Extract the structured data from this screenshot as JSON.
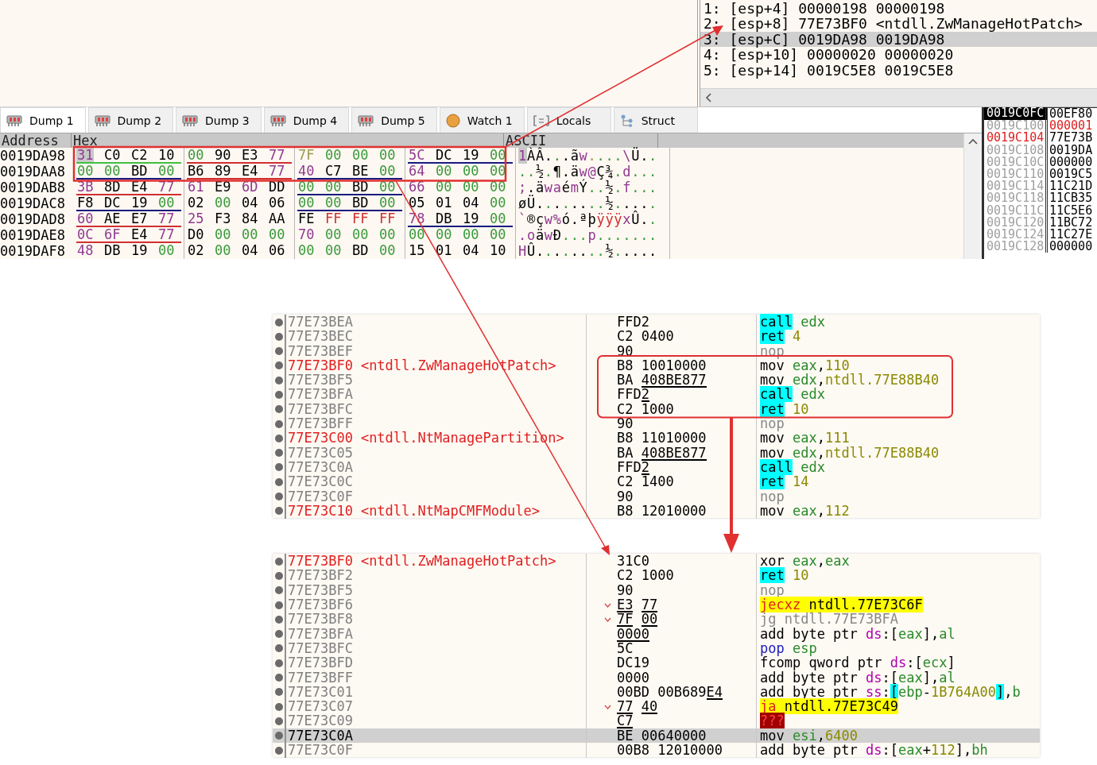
{
  "stack": {
    "rows": [
      {
        "text": "1: [esp+4] 00000198 00000198",
        "selected": false
      },
      {
        "text": "2: [esp+8] 77E73BF0 <ntdll.ZwManageHotPatch>",
        "selected": false
      },
      {
        "text": "3: [esp+C] 0019DA98 0019DA98",
        "selected": true
      },
      {
        "text": "4: [esp+10] 00000020 00000020",
        "selected": false
      },
      {
        "text": "5: [esp+14] 0019C5E8 0019C5E8",
        "selected": false
      }
    ]
  },
  "dump_tabs": [
    {
      "label": "Dump 1",
      "kind": "dump",
      "selected": true
    },
    {
      "label": "Dump 2",
      "kind": "dump",
      "selected": false
    },
    {
      "label": "Dump 3",
      "kind": "dump",
      "selected": false
    },
    {
      "label": "Dump 4",
      "kind": "dump",
      "selected": false
    },
    {
      "label": "Dump 5",
      "kind": "dump",
      "selected": false
    },
    {
      "label": "Watch 1",
      "kind": "watch",
      "selected": false
    },
    {
      "label": "Locals",
      "kind": "locals",
      "selected": false
    },
    {
      "label": "Struct",
      "kind": "struct",
      "selected": false
    }
  ],
  "dump": {
    "columns": [
      "Address",
      "Hex",
      "ASCII"
    ],
    "rows": [
      {
        "address": "0019DA98",
        "groups": [
          {
            "color": "#40c040",
            "bytes": [
              {
                "text": "31",
                "color": "#903a90",
                "selected": true
              },
              {
                "text": "C0",
                "color": "#000000",
                "selected": false
              },
              {
                "text": "C2",
                "color": "#000000",
                "selected": false
              },
              {
                "text": "10",
                "color": "#000000",
                "selected": false
              }
            ]
          },
          {
            "color": "#d03030",
            "bytes": [
              {
                "text": "00",
                "color": "#3a9a3a",
                "selected": false
              },
              {
                "text": "90",
                "color": "#000000",
                "selected": false
              },
              {
                "text": "E3",
                "color": "#000000",
                "selected": false
              },
              {
                "text": "77",
                "color": "#903a90",
                "selected": false
              }
            ]
          },
          {
            "bytes": [
              {
                "text": "7F",
                "color": "#9a9a50",
                "selected": false
              },
              {
                "text": "00",
                "color": "#3a9a3a",
                "selected": false
              },
              {
                "text": "00",
                "color": "#3a9a3a",
                "selected": false
              },
              {
                "text": "00",
                "color": "#3a9a3a",
                "selected": false
              }
            ]
          },
          {
            "color": "#1a1a80",
            "bytes": [
              {
                "text": "5C",
                "color": "#903a90",
                "selected": false
              },
              {
                "text": "DC",
                "color": "#000000",
                "selected": false
              },
              {
                "text": "19",
                "color": "#000000",
                "selected": false
              },
              {
                "text": "00",
                "color": "#3a9a3a",
                "selected": false
              }
            ]
          }
        ],
        "ascii": "1ÀÂ...ãw....\\Ü.."
      },
      {
        "address": "0019DAA8",
        "groups": [
          {
            "color": "#1a1a80",
            "bytes": [
              {
                "text": "00",
                "color": "#3a9a3a",
                "selected": false
              },
              {
                "text": "00",
                "color": "#3a9a3a",
                "selected": false
              },
              {
                "text": "BD",
                "color": "#000000",
                "selected": false
              },
              {
                "text": "00",
                "color": "#3a9a3a",
                "selected": false
              }
            ]
          },
          {
            "color": "#d03030",
            "bytes": [
              {
                "text": "B6",
                "color": "#000000",
                "selected": false
              },
              {
                "text": "89",
                "color": "#000000",
                "selected": false
              },
              {
                "text": "E4",
                "color": "#000000",
                "selected": false
              },
              {
                "text": "77",
                "color": "#903a90",
                "selected": false
              }
            ]
          },
          {
            "color": "#1a1a80",
            "bytes": [
              {
                "text": "40",
                "color": "#903a90",
                "selected": false
              },
              {
                "text": "C7",
                "color": "#000000",
                "selected": false
              },
              {
                "text": "BE",
                "color": "#000000",
                "selected": false
              },
              {
                "text": "00",
                "color": "#3a9a3a",
                "selected": false
              }
            ]
          },
          {
            "bytes": [
              {
                "text": "64",
                "color": "#903a90",
                "selected": false
              },
              {
                "text": "00",
                "color": "#3a9a3a",
                "selected": false
              },
              {
                "text": "00",
                "color": "#3a9a3a",
                "selected": false
              },
              {
                "text": "00",
                "color": "#3a9a3a",
                "selected": false
              }
            ]
          }
        ],
        "ascii": "..½.¶.äw@Ç¾.d..."
      },
      {
        "address": "0019DAB8",
        "groups": [
          {
            "color": "#d03030",
            "bytes": [
              {
                "text": "3B",
                "color": "#903a90",
                "selected": false
              },
              {
                "text": "8D",
                "color": "#000000",
                "selected": false
              },
              {
                "text": "E4",
                "color": "#000000",
                "selected": false
              },
              {
                "text": "77",
                "color": "#903a90",
                "selected": false
              }
            ]
          },
          {
            "bytes": [
              {
                "text": "61",
                "color": "#903a90",
                "selected": false
              },
              {
                "text": "E9",
                "color": "#000000",
                "selected": false
              },
              {
                "text": "6D",
                "color": "#903a90",
                "selected": false
              },
              {
                "text": "DD",
                "color": "#000000",
                "selected": false
              }
            ]
          },
          {
            "color": "#1a1a80",
            "bytes": [
              {
                "text": "00",
                "color": "#3a9a3a",
                "selected": false
              },
              {
                "text": "00",
                "color": "#3a9a3a",
                "selected": false
              },
              {
                "text": "BD",
                "color": "#000000",
                "selected": false
              },
              {
                "text": "00",
                "color": "#3a9a3a",
                "selected": false
              }
            ]
          },
          {
            "bytes": [
              {
                "text": "66",
                "color": "#903a90",
                "selected": false
              },
              {
                "text": "00",
                "color": "#3a9a3a",
                "selected": false
              },
              {
                "text": "00",
                "color": "#3a9a3a",
                "selected": false
              },
              {
                "text": "00",
                "color": "#3a9a3a",
                "selected": false
              }
            ]
          }
        ],
        "ascii": ";.äwaémÝ..½.f..."
      },
      {
        "address": "0019DAC8",
        "groups": [
          {
            "color": "#1a1a80",
            "bytes": [
              {
                "text": "F8",
                "color": "#000000",
                "selected": false
              },
              {
                "text": "DC",
                "color": "#000000",
                "selected": false
              },
              {
                "text": "19",
                "color": "#000000",
                "selected": false
              },
              {
                "text": "00",
                "color": "#3a9a3a",
                "selected": false
              }
            ]
          },
          {
            "bytes": [
              {
                "text": "02",
                "color": "#000000",
                "selected": false
              },
              {
                "text": "00",
                "color": "#3a9a3a",
                "selected": false
              },
              {
                "text": "04",
                "color": "#000000",
                "selected": false
              },
              {
                "text": "06",
                "color": "#000000",
                "selected": false
              }
            ]
          },
          {
            "color": "#1a1a80",
            "bytes": [
              {
                "text": "00",
                "color": "#3a9a3a",
                "selected": false
              },
              {
                "text": "00",
                "color": "#3a9a3a",
                "selected": false
              },
              {
                "text": "BD",
                "color": "#000000",
                "selected": false
              },
              {
                "text": "00",
                "color": "#3a9a3a",
                "selected": false
              }
            ]
          },
          {
            "bytes": [
              {
                "text": "05",
                "color": "#000000",
                "selected": false
              },
              {
                "text": "01",
                "color": "#000000",
                "selected": false
              },
              {
                "text": "04",
                "color": "#000000",
                "selected": false
              },
              {
                "text": "00",
                "color": "#3a9a3a",
                "selected": false
              }
            ]
          }
        ],
        "ascii": "øÜ........½....."
      },
      {
        "address": "0019DAD8",
        "groups": [
          {
            "color": "#d03030",
            "bytes": [
              {
                "text": "60",
                "color": "#903a90",
                "selected": false
              },
              {
                "text": "AE",
                "color": "#000000",
                "selected": false
              },
              {
                "text": "E7",
                "color": "#000000",
                "selected": false
              },
              {
                "text": "77",
                "color": "#903a90",
                "selected": false
              }
            ]
          },
          {
            "bytes": [
              {
                "text": "25",
                "color": "#903a90",
                "selected": false
              },
              {
                "text": "F3",
                "color": "#000000",
                "selected": false
              },
              {
                "text": "84",
                "color": "#000000",
                "selected": false
              },
              {
                "text": "AA",
                "color": "#000000",
                "selected": false
              }
            ]
          },
          {
            "bytes": [
              {
                "text": "FE",
                "color": "#000000",
                "selected": false
              },
              {
                "text": "FF",
                "color": "#d03030",
                "selected": false
              },
              {
                "text": "FF",
                "color": "#d03030",
                "selected": false
              },
              {
                "text": "FF",
                "color": "#d03030",
                "selected": false
              }
            ]
          },
          {
            "color": "#1a1a80",
            "bytes": [
              {
                "text": "78",
                "color": "#903a90",
                "selected": false
              },
              {
                "text": "DB",
                "color": "#000000",
                "selected": false
              },
              {
                "text": "19",
                "color": "#000000",
                "selected": false
              },
              {
                "text": "00",
                "color": "#3a9a3a",
                "selected": false
              }
            ]
          }
        ],
        "ascii": "`®çw%ó.ªþÿÿÿxÛ.."
      },
      {
        "address": "0019DAE8",
        "groups": [
          {
            "color": "#d03030",
            "bytes": [
              {
                "text": "0C",
                "color": "#903a90",
                "selected": false
              },
              {
                "text": "6F",
                "color": "#903a90",
                "selected": false
              },
              {
                "text": "E4",
                "color": "#000000",
                "selected": false
              },
              {
                "text": "77",
                "color": "#903a90",
                "selected": false
              }
            ]
          },
          {
            "bytes": [
              {
                "text": "D0",
                "color": "#000000",
                "selected": false
              },
              {
                "text": "00",
                "color": "#3a9a3a",
                "selected": false
              },
              {
                "text": "00",
                "color": "#3a9a3a",
                "selected": false
              },
              {
                "text": "00",
                "color": "#3a9a3a",
                "selected": false
              }
            ]
          },
          {
            "bytes": [
              {
                "text": "70",
                "color": "#903a90",
                "selected": false
              },
              {
                "text": "00",
                "color": "#3a9a3a",
                "selected": false
              },
              {
                "text": "00",
                "color": "#3a9a3a",
                "selected": false
              },
              {
                "text": "00",
                "color": "#3a9a3a",
                "selected": false
              }
            ]
          },
          {
            "bytes": [
              {
                "text": "00",
                "color": "#3a9a3a",
                "selected": false
              },
              {
                "text": "00",
                "color": "#3a9a3a",
                "selected": false
              },
              {
                "text": "00",
                "color": "#3a9a3a",
                "selected": false
              },
              {
                "text": "00",
                "color": "#3a9a3a",
                "selected": false
              }
            ]
          }
        ],
        "ascii": ".oäwÐ...p......."
      },
      {
        "address": "0019DAF8",
        "groups": [
          {
            "bytes": [
              {
                "text": "48",
                "color": "#903a90",
                "selected": false
              },
              {
                "text": "DB",
                "color": "#000000",
                "selected": false
              },
              {
                "text": "19",
                "color": "#000000",
                "selected": false
              },
              {
                "text": "00",
                "color": "#3a9a3a",
                "selected": false
              }
            ]
          },
          {
            "bytes": [
              {
                "text": "02",
                "color": "#000000",
                "selected": false
              },
              {
                "text": "00",
                "color": "#3a9a3a",
                "selected": false
              },
              {
                "text": "04",
                "color": "#000000",
                "selected": false
              },
              {
                "text": "06",
                "color": "#000000",
                "selected": false
              }
            ]
          },
          {
            "bytes": [
              {
                "text": "00",
                "color": "#3a9a3a",
                "selected": false
              },
              {
                "text": "00",
                "color": "#3a9a3a",
                "selected": false
              },
              {
                "text": "BD",
                "color": "#000000",
                "selected": false
              },
              {
                "text": "00",
                "color": "#3a9a3a",
                "selected": false
              }
            ]
          },
          {
            "bytes": [
              {
                "text": "15",
                "color": "#000000",
                "selected": false
              },
              {
                "text": "01",
                "color": "#000000",
                "selected": false
              },
              {
                "text": "04",
                "color": "#000000",
                "selected": false
              },
              {
                "text": "10",
                "color": "#000000",
                "selected": false
              }
            ]
          }
        ],
        "ascii": "HÛ........½....."
      }
    ]
  },
  "mini_stack": {
    "header": [
      "0019C0FC",
      "00EF80"
    ],
    "rows": [
      {
        "address": {
          "text": "0019C100",
          "color": "#a0a0a0"
        },
        "value": {
          "text": "000001",
          "color": "#e02020"
        }
      },
      {
        "address": {
          "text": "0019C104",
          "color": "#e02020"
        },
        "value": {
          "text": "77E73B",
          "color": "#000000"
        }
      },
      {
        "address": {
          "text": "0019C108",
          "color": "#a0a0a0"
        },
        "value": {
          "text": "0019DA",
          "color": "#000000"
        }
      },
      {
        "address": {
          "text": "0019C10C",
          "color": "#a0a0a0"
        },
        "value": {
          "text": "000000",
          "color": "#000000"
        }
      },
      {
        "address": {
          "text": "0019C110",
          "color": "#a0a0a0"
        },
        "value": {
          "text": "0019C5",
          "color": "#000000"
        }
      },
      {
        "address": {
          "text": "0019C114",
          "color": "#a0a0a0"
        },
        "value": {
          "text": "11C21D",
          "color": "#000000"
        }
      },
      {
        "address": {
          "text": "0019C118",
          "color": "#a0a0a0"
        },
        "value": {
          "text": "11CB35",
          "color": "#000000"
        }
      },
      {
        "address": {
          "text": "0019C11C",
          "color": "#a0a0a0"
        },
        "value": {
          "text": "11C5E6",
          "color": "#000000"
        }
      },
      {
        "address": {
          "text": "0019C120",
          "color": "#a0a0a0"
        },
        "value": {
          "text": "11BC72",
          "color": "#000000"
        }
      },
      {
        "address": {
          "text": "0019C124",
          "color": "#a0a0a0"
        },
        "value": {
          "text": "11C27E",
          "color": "#000000"
        }
      },
      {
        "address": {
          "text": "0019C128",
          "color": "#a0a0a0"
        },
        "value": {
          "text": "000000",
          "color": "#000000"
        }
      }
    ]
  },
  "disassembly": [
    {
      "rows": [
        {
          "address": "77E73BEA",
          "selected": false,
          "jump": false,
          "bytes": [
            {
              "text": "FFD2",
              "underlined": false
            }
          ],
          "instruction": [
            {
              "text": "call",
              "kind": "control"
            },
            {
              "text": " edx",
              "kind": "register"
            }
          ]
        },
        {
          "address": "77E73BEC",
          "selected": false,
          "jump": false,
          "bytes": [
            {
              "text": "C2 0400",
              "underlined": false
            }
          ],
          "instruction": [
            {
              "text": "ret",
              "kind": "control"
            },
            {
              "text": " 4",
              "kind": "number"
            }
          ]
        },
        {
          "address": "77E73BEF",
          "selected": false,
          "jump": false,
          "bytes": [
            {
              "text": "90",
              "underlined": false
            }
          ],
          "instruction": [
            {
              "text": "nop",
              "kind": "muted"
            }
          ]
        },
        {
          "address": "77E73BF0",
          "label": "<ntdll.ZwManageHotPatch>",
          "selected": false,
          "jump": false,
          "bytes": [
            {
              "text": "B8 10010000",
              "underlined": false
            }
          ],
          "instruction": [
            {
              "text": "mov ",
              "kind": "plain"
            },
            {
              "text": "eax",
              "kind": "register"
            },
            {
              "text": ",",
              "kind": "plain"
            },
            {
              "text": "110",
              "kind": "number"
            }
          ]
        },
        {
          "address": "77E73BF5",
          "selected": false,
          "jump": false,
          "bytes": [
            {
              "text": "BA ",
              "underlined": false
            },
            {
              "text": "408BE877",
              "underlined": true
            }
          ],
          "instruction": [
            {
              "text": "mov ",
              "kind": "plain"
            },
            {
              "text": "edx",
              "kind": "register"
            },
            {
              "text": ",",
              "kind": "plain"
            },
            {
              "text": "ntdll.77E88B40",
              "kind": "number"
            }
          ]
        },
        {
          "address": "77E73BFA",
          "selected": false,
          "jump": false,
          "bytes": [
            {
              "text": "FFD",
              "underlined": false
            },
            {
              "text": "2",
              "underlined": true
            }
          ],
          "instruction": [
            {
              "text": "call",
              "kind": "control"
            },
            {
              "text": " edx",
              "kind": "register"
            }
          ]
        },
        {
          "address": "77E73BFC",
          "selected": false,
          "jump": false,
          "bytes": [
            {
              "text": "C2 1000",
              "underlined": false
            }
          ],
          "instruction": [
            {
              "text": "ret",
              "kind": "control"
            },
            {
              "text": " 10",
              "kind": "number"
            }
          ]
        },
        {
          "address": "77E73BFF",
          "selected": false,
          "jump": false,
          "bytes": [
            {
              "text": "90",
              "underlined": false
            }
          ],
          "instruction": [
            {
              "text": "nop",
              "kind": "muted"
            }
          ]
        },
        {
          "address": "77E73C00",
          "label": "<ntdll.NtManagePartition>",
          "selected": false,
          "jump": false,
          "bytes": [
            {
              "text": "B8 11010000",
              "underlined": false
            }
          ],
          "instruction": [
            {
              "text": "mov ",
              "kind": "plain"
            },
            {
              "text": "eax",
              "kind": "register"
            },
            {
              "text": ",",
              "kind": "plain"
            },
            {
              "text": "111",
              "kind": "number"
            }
          ]
        },
        {
          "address": "77E73C05",
          "selected": false,
          "jump": false,
          "bytes": [
            {
              "text": "BA ",
              "underlined": false
            },
            {
              "text": "408BE877",
              "underlined": true
            }
          ],
          "instruction": [
            {
              "text": "mov ",
              "kind": "plain"
            },
            {
              "text": "edx",
              "kind": "register"
            },
            {
              "text": ",",
              "kind": "plain"
            },
            {
              "text": "ntdll.77E88B40",
              "kind": "number"
            }
          ]
        },
        {
          "address": "77E73C0A",
          "selected": false,
          "jump": false,
          "bytes": [
            {
              "text": "FFD",
              "underlined": false
            },
            {
              "text": "2",
              "underlined": true
            }
          ],
          "instruction": [
            {
              "text": "call",
              "kind": "control"
            },
            {
              "text": " edx",
              "kind": "register"
            }
          ]
        },
        {
          "address": "77E73C0C",
          "selected": false,
          "jump": false,
          "bytes": [
            {
              "text": "C2 1400",
              "underlined": false
            }
          ],
          "instruction": [
            {
              "text": "ret",
              "kind": "control"
            },
            {
              "text": " 14",
              "kind": "number"
            }
          ]
        },
        {
          "address": "77E73C0F",
          "selected": false,
          "jump": false,
          "bytes": [
            {
              "text": "90",
              "underlined": false
            }
          ],
          "instruction": [
            {
              "text": "nop",
              "kind": "muted"
            }
          ]
        },
        {
          "address": "77E73C10",
          "label": "<ntdll.NtMapCMFModule>",
          "selected": false,
          "jump": false,
          "bytes": [
            {
              "text": "B8 12010000",
              "underlined": false
            }
          ],
          "instruction": [
            {
              "text": "mov ",
              "kind": "plain"
            },
            {
              "text": "eax",
              "kind": "register"
            },
            {
              "text": ",",
              "kind": "plain"
            },
            {
              "text": "112",
              "kind": "number"
            }
          ]
        }
      ]
    },
    {
      "rows": [
        {
          "address": "77E73BF0",
          "label": "<ntdll.ZwManageHotPatch>",
          "selected": false,
          "jump": false,
          "bytes": [
            {
              "text": "31C0",
              "underlined": false
            }
          ],
          "instruction": [
            {
              "text": "xor ",
              "kind": "plain"
            },
            {
              "text": "eax",
              "kind": "register"
            },
            {
              "text": ",",
              "kind": "plain"
            },
            {
              "text": "eax",
              "kind": "register"
            }
          ]
        },
        {
          "address": "77E73BF2",
          "selected": false,
          "jump": false,
          "bytes": [
            {
              "text": "C2 1000",
              "underlined": false
            }
          ],
          "instruction": [
            {
              "text": "ret",
              "kind": "control"
            },
            {
              "text": " 10",
              "kind": "number"
            }
          ]
        },
        {
          "address": "77E73BF5",
          "selected": false,
          "jump": false,
          "bytes": [
            {
              "text": "90",
              "underlined": false
            }
          ],
          "instruction": [
            {
              "text": "nop",
              "kind": "muted"
            }
          ]
        },
        {
          "address": "77E73BF6",
          "selected": false,
          "jump": true,
          "bytes": [
            {
              "text": "E3",
              "underlined": true
            },
            {
              "text": " 77",
              "underlined": true
            }
          ],
          "instruction": [
            {
              "text": "jecxz",
              "kind": "branch"
            },
            {
              "text": " ntdll.77E73C6F",
              "kind": "target"
            }
          ]
        },
        {
          "address": "77E73BF8",
          "selected": false,
          "jump": true,
          "bytes": [
            {
              "text": "7F",
              "underlined": true
            },
            {
              "text": " 00",
              "underlined": true
            }
          ],
          "instruction": [
            {
              "text": "jg ntdll.77E73BFA",
              "kind": "muted"
            }
          ]
        },
        {
          "address": "77E73BFA",
          "selected": false,
          "jump": false,
          "bytes": [
            {
              "text": "0000",
              "underlined": true
            }
          ],
          "instruction": [
            {
              "text": "add byte ptr ",
              "kind": "plain"
            },
            {
              "text": "ds",
              "kind": "segment"
            },
            {
              "text": ":[",
              "kind": "plain"
            },
            {
              "text": "eax",
              "kind": "register"
            },
            {
              "text": "],",
              "kind": "plain"
            },
            {
              "text": "al",
              "kind": "register"
            }
          ]
        },
        {
          "address": "77E73BFC",
          "selected": false,
          "jump": false,
          "bytes": [
            {
              "text": "5C",
              "underlined": false
            }
          ],
          "instruction": [
            {
              "text": "pop",
              "kind": "stack"
            },
            {
              "text": " esp",
              "kind": "register"
            }
          ]
        },
        {
          "address": "77E73BFD",
          "selected": false,
          "jump": false,
          "bytes": [
            {
              "text": "DC19",
              "underlined": false
            }
          ],
          "instruction": [
            {
              "text": "fcomp qword ptr ",
              "kind": "plain"
            },
            {
              "text": "ds",
              "kind": "segment"
            },
            {
              "text": ":[",
              "kind": "plain"
            },
            {
              "text": "ecx",
              "kind": "register"
            },
            {
              "text": "]",
              "kind": "plain"
            }
          ]
        },
        {
          "address": "77E73BFF",
          "selected": false,
          "jump": false,
          "bytes": [
            {
              "text": "0000",
              "underlined": false
            }
          ],
          "instruction": [
            {
              "text": "add byte ptr ",
              "kind": "plain"
            },
            {
              "text": "ds",
              "kind": "segment"
            },
            {
              "text": ":[",
              "kind": "plain"
            },
            {
              "text": "eax",
              "kind": "register"
            },
            {
              "text": "],",
              "kind": "plain"
            },
            {
              "text": "al",
              "kind": "register"
            }
          ]
        },
        {
          "address": "77E73C01",
          "selected": false,
          "jump": false,
          "bytes": [
            {
              "text": "00BD 00B689",
              "underlined": false
            },
            {
              "text": "E4",
              "underlined": true
            }
          ],
          "instruction": [
            {
              "text": "add byte ptr ",
              "kind": "plain"
            },
            {
              "text": "ss",
              "kind": "segment"
            },
            {
              "text": ":",
              "kind": "plain"
            },
            {
              "text": "[",
              "kind": "control"
            },
            {
              "text": "ebp",
              "kind": "register"
            },
            {
              "text": "-",
              "kind": "plain"
            },
            {
              "text": "1B764A00",
              "kind": "number"
            },
            {
              "text": "]",
              "kind": "control"
            },
            {
              "text": ",",
              "kind": "plain"
            },
            {
              "text": "b",
              "kind": "register"
            }
          ]
        },
        {
          "address": "77E73C07",
          "selected": false,
          "jump": true,
          "bytes": [
            {
              "text": "77",
              "underlined": true
            },
            {
              "text": " 40",
              "underlined": true
            }
          ],
          "instruction": [
            {
              "text": "ja",
              "kind": "branch"
            },
            {
              "text": " ntdll.77E73C49",
              "kind": "target"
            }
          ]
        },
        {
          "address": "77E73C09",
          "selected": false,
          "jump": false,
          "bytes": [
            {
              "text": "C7",
              "underlined": true
            }
          ],
          "instruction": [
            {
              "text": "???",
              "kind": "invalid"
            }
          ]
        },
        {
          "address": "77E73C0A",
          "selected": true,
          "jump": false,
          "bytes": [
            {
              "text": "BE 00640000",
              "underlined": false
            }
          ],
          "instruction": [
            {
              "text": "mov ",
              "kind": "plain"
            },
            {
              "text": "esi",
              "kind": "register"
            },
            {
              "text": ",",
              "kind": "plain"
            },
            {
              "text": "6400",
              "kind": "number"
            }
          ]
        },
        {
          "address": "77E73C0F",
          "selected": false,
          "jump": false,
          "bytes": [
            {
              "text": "00B8 12010000",
              "underlined": false
            }
          ],
          "instruction": [
            {
              "text": "add byte ptr ",
              "kind": "plain"
            },
            {
              "text": "ds",
              "kind": "segment"
            },
            {
              "text": ":[",
              "kind": "plain"
            },
            {
              "text": "eax",
              "kind": "register"
            },
            {
              "text": "+",
              "kind": "plain"
            },
            {
              "text": "112",
              "kind": "number"
            },
            {
              "text": "],",
              "kind": "plain"
            },
            {
              "text": "bh",
              "kind": "register"
            }
          ]
        }
      ]
    }
  ]
}
